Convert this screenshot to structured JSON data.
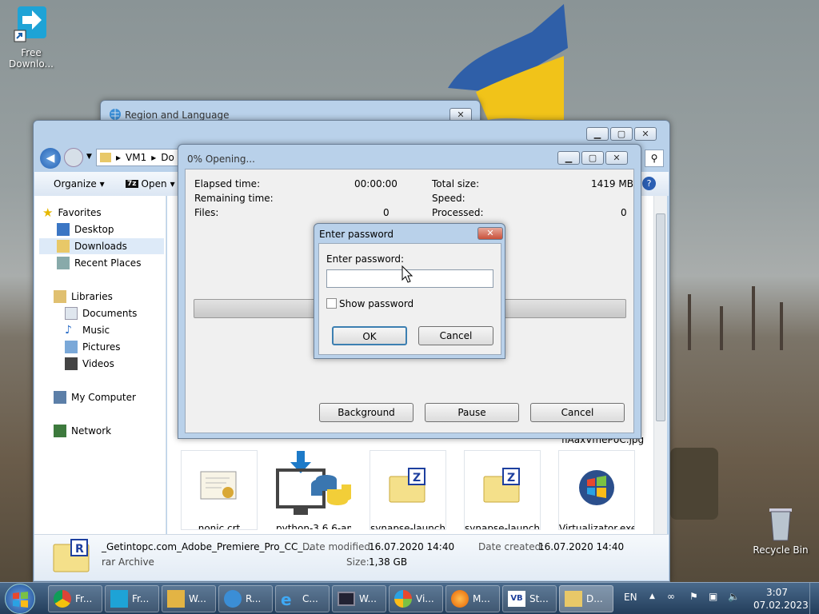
{
  "desktop": {
    "icons": [
      {
        "label": "Free Downlo..."
      },
      {
        "label": "Recycle Bin"
      }
    ]
  },
  "region_window": {
    "title": "Region and Language"
  },
  "explorer": {
    "breadcrumb": [
      "VM1",
      "Do"
    ],
    "toolbar": {
      "organize": "Organize",
      "open": "Open"
    },
    "nav": {
      "favorites": "Favorites",
      "desktop": "Desktop",
      "downloads": "Downloads",
      "recent": "Recent Places",
      "libraries": "Libraries",
      "documents": "Documents",
      "music": "Music",
      "pictures": "Pictures",
      "videos": "Videos",
      "computer": "My Computer",
      "network": "Network"
    },
    "files": [
      {
        "name": "nonic.crt"
      },
      {
        "name": "python-3.6.6-am..."
      },
      {
        "name": "synapse-launcher..."
      },
      {
        "name": "synapse-launcher..."
      },
      {
        "name": "Virtualizator.exe"
      }
    ],
    "partial_filename": "flAaxVmeP0C.jpg",
    "details": {
      "name": "_Getintopc.com_Adobe_Premiere_Pro_CC_...",
      "type": "rar Archive",
      "modified_label": "Date modified:",
      "modified": "16.07.2020 14:40",
      "created_label": "Date created:",
      "created": "16.07.2020 14:40",
      "size_label": "Size:",
      "size": "1,38 GB"
    }
  },
  "progress_window": {
    "title": "0% Opening...",
    "elapsed_label": "Elapsed time:",
    "elapsed": "00:00:00",
    "remaining_label": "Remaining time:",
    "remaining": "",
    "files_label": "Files:",
    "files": "0",
    "total_label": "Total size:",
    "total": "1419 MB",
    "speed_label": "Speed:",
    "speed": "",
    "processed_label": "Processed:",
    "processed": "0",
    "progress": 0,
    "buttons": {
      "background": "Background",
      "pause": "Pause",
      "cancel": "Cancel"
    }
  },
  "password_dialog": {
    "title": "Enter password",
    "field_label": "Enter password:",
    "password": "",
    "show_label": "Show password",
    "ok": "OK",
    "cancel": "Cancel"
  },
  "taskbar": {
    "items": [
      {
        "label": "Fr...",
        "icon": "chrome-icon"
      },
      {
        "label": "Fr...",
        "icon": "free-download-icon"
      },
      {
        "label": "W...",
        "icon": "windows-update-icon"
      },
      {
        "label": "R...",
        "icon": "region-globe-icon"
      },
      {
        "label": "C...",
        "icon": "ie-icon"
      },
      {
        "label": "W...",
        "icon": "task-manager-icon"
      },
      {
        "label": "Vi...",
        "icon": "virtualizator-icon"
      },
      {
        "label": "M...",
        "icon": "firefox-icon"
      },
      {
        "label": "St...",
        "icon": "vb-icon"
      },
      {
        "label": "D...",
        "icon": "folder-icon"
      }
    ],
    "lang": "EN",
    "time": "3:07",
    "date": "07.02.2023"
  }
}
